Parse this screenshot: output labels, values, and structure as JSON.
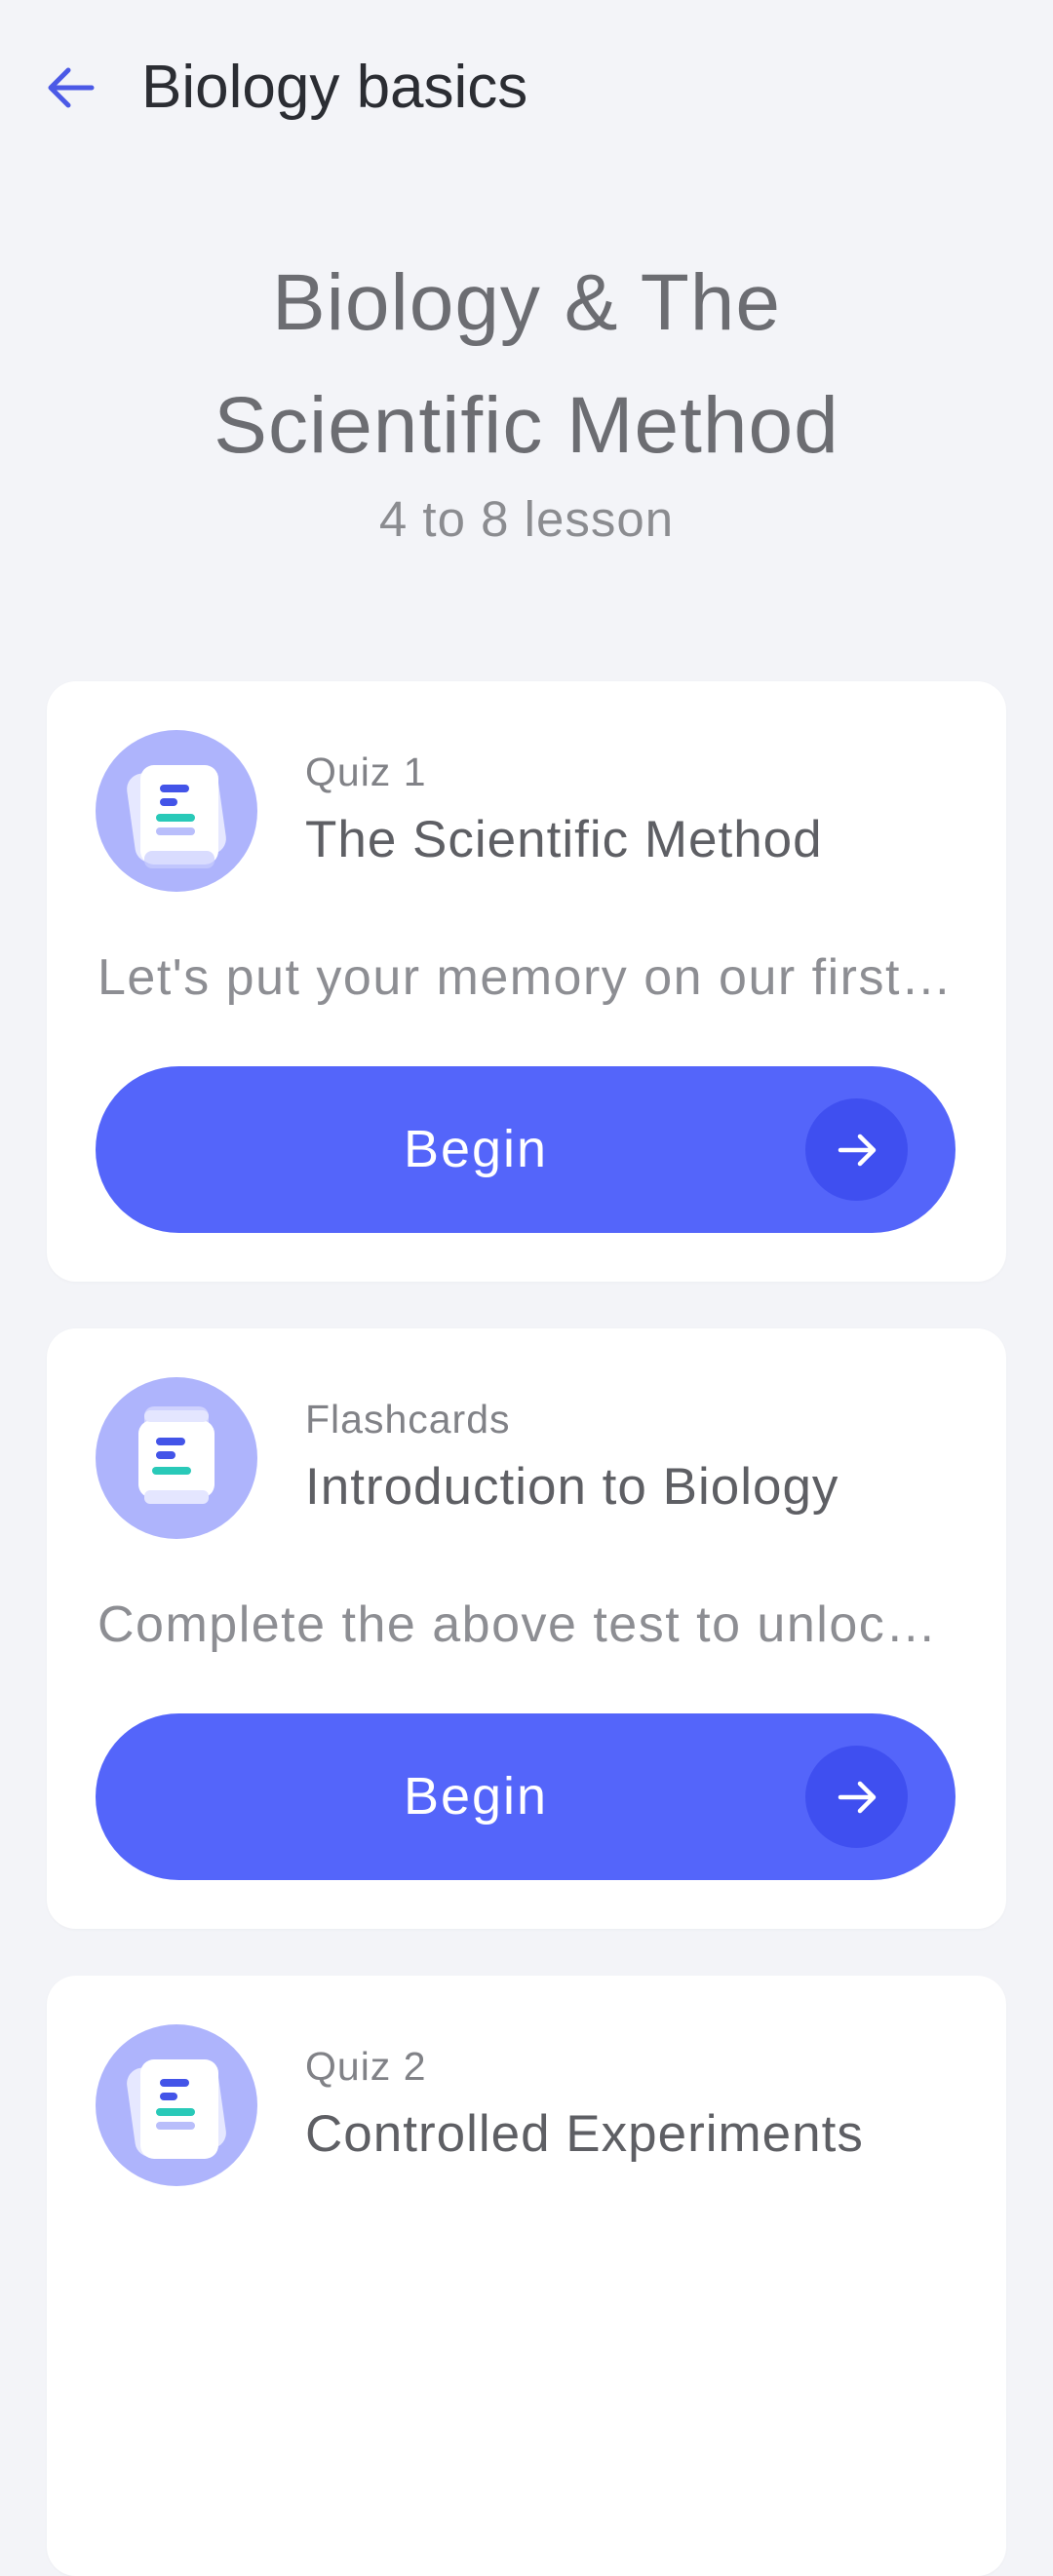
{
  "header": {
    "title": "Biology basics",
    "back_icon": "arrow-left-icon"
  },
  "hero": {
    "title_line1": "Biology & The",
    "title_line2": "Scientific Method",
    "subtitle": "4 to 8 lesson"
  },
  "cards": [
    {
      "kicker": "Quiz 1",
      "title": "The Scientific Method",
      "description": "Let's put your memory on our first test!",
      "button_label": "Begin",
      "icon": "quiz-document-icon"
    },
    {
      "kicker": "Flashcards",
      "title": "Introduction to Biology",
      "description": "Complete the above test to unlock flashcards",
      "button_label": "Begin",
      "icon": "flashcards-icon"
    },
    {
      "kicker": "Quiz 2",
      "title": "Controlled Experiments",
      "icon": "quiz-document-icon"
    }
  ],
  "colors": {
    "background": "#f3f4f8",
    "accent": "#5465fa",
    "accent_dark": "#3f4ff0",
    "icon_circle": "#aeb4fc"
  }
}
